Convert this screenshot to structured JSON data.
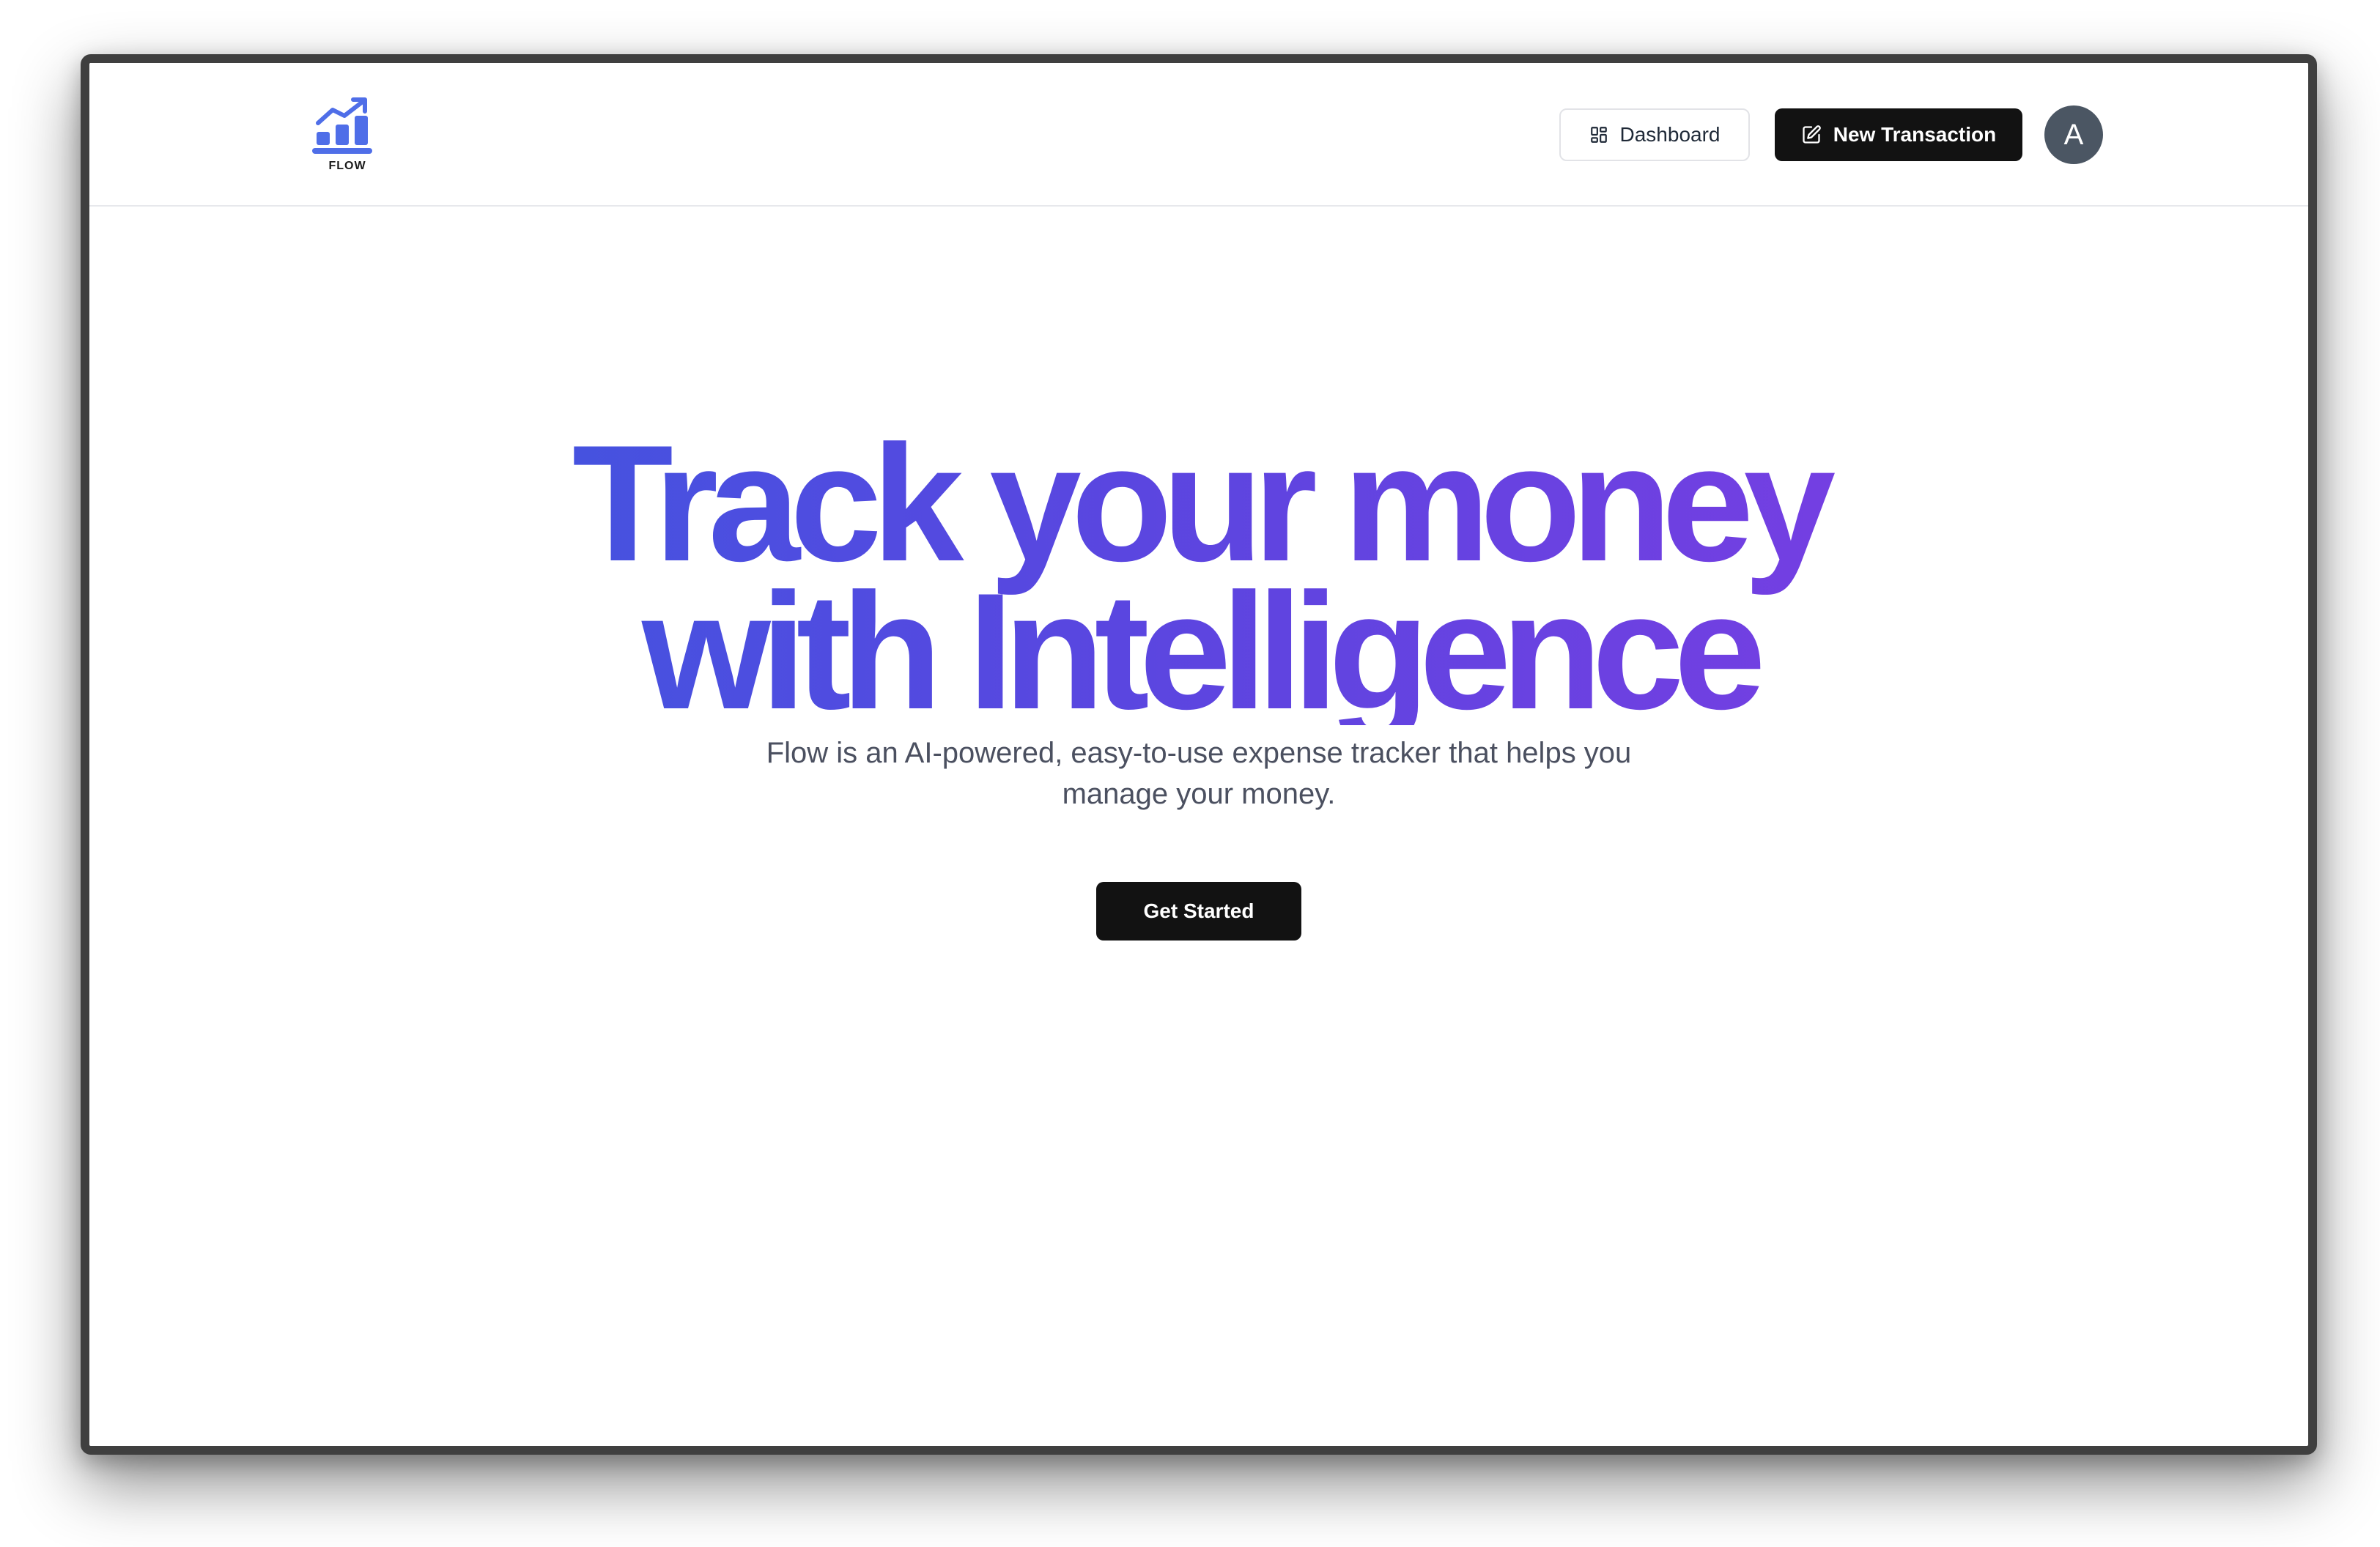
{
  "brand": {
    "logo_text": "FLOW",
    "logo_color": "#4f6ee8"
  },
  "navbar": {
    "dashboard_label": "Dashboard",
    "dashboard_icon": "layout-grid-icon",
    "new_transaction_label": "New Transaction",
    "new_transaction_icon": "pencil-square-icon",
    "avatar_initial": "A"
  },
  "hero": {
    "title_line1": "Track your money",
    "title_line2": "with Intelligence",
    "subtitle": "Flow is an AI-powered, easy-to-use expense tracker that helps you manage your money.",
    "cta_label": "Get Started",
    "gradient_start": "#3f56df",
    "gradient_end": "#7a3de2"
  }
}
